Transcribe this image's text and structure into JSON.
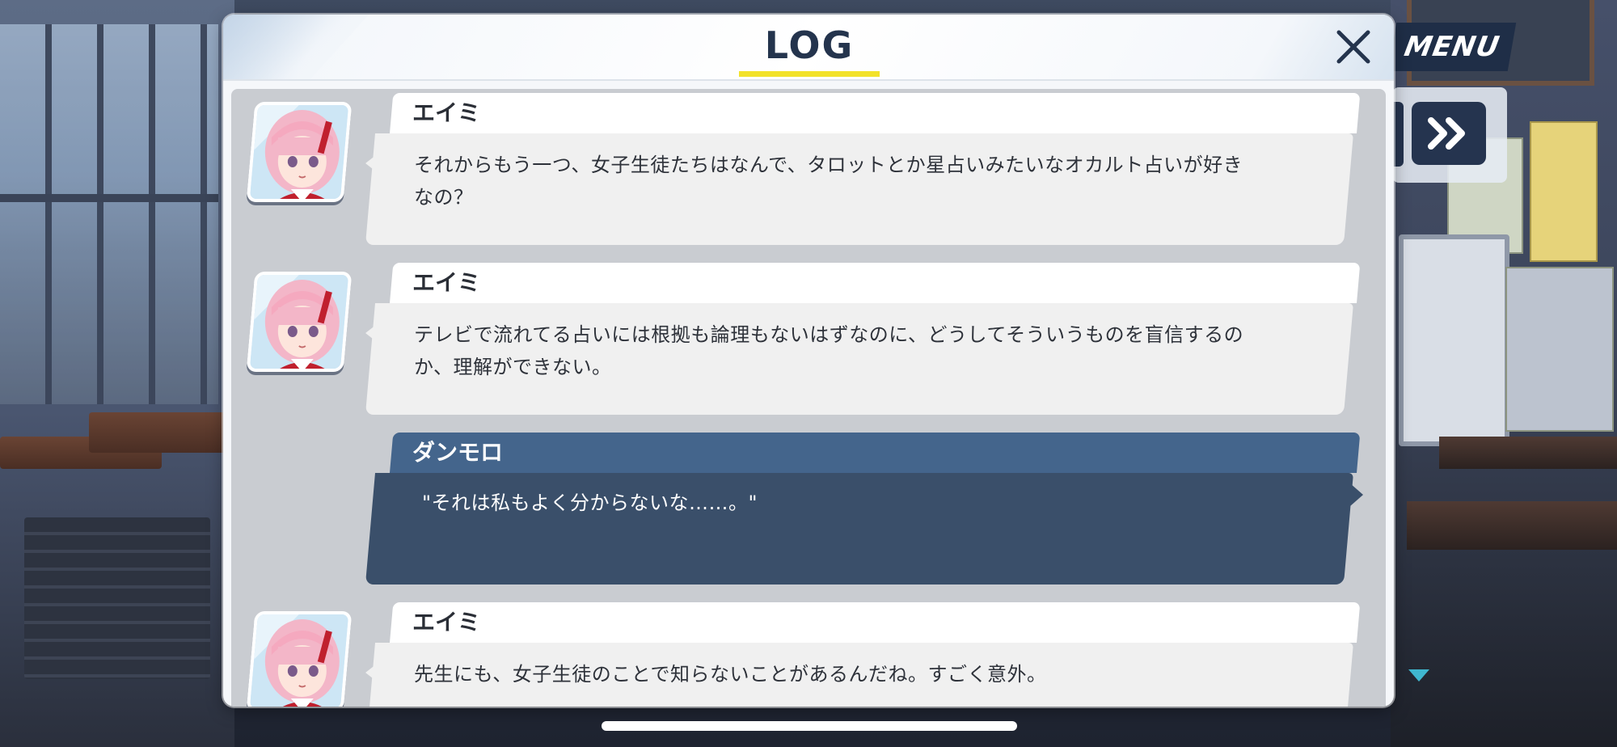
{
  "log": {
    "title": "LOG",
    "close_icon": "close-x-icon"
  },
  "menu": {
    "label": "MENU",
    "skip_label": "»",
    "skip_icon": "fast-forward-icon"
  },
  "entries": [
    {
      "speaker": "エイミ",
      "lines": [
        "それからもう一つ、女子生徒たちはなんで、タロットとか星占いみたいなオカルト占いが好き",
        "なの？"
      ],
      "type": "character"
    },
    {
      "speaker": "エイミ",
      "lines": [
        "テレビで流れてる占いには根拠も論理もないはずなのに、どうしてそういうものを盲信するの",
        "か、理解ができない。"
      ],
      "type": "character"
    },
    {
      "speaker": "ダンモロ",
      "lines": [
        "\"それは私もよく分からないな……。\""
      ],
      "type": "player"
    },
    {
      "speaker": "エイミ",
      "lines": [
        "先生にも、女子生徒のことで知らないことがあるんだね。すごく意外。"
      ],
      "type": "character"
    }
  ],
  "colors": {
    "title_underline": "#f2e22a",
    "player_name_bar": "#44658c",
    "player_bubble": "#3a4f6a",
    "menu_bg": "#1f2e47",
    "scroll_indicator": "#3fb7cf"
  }
}
